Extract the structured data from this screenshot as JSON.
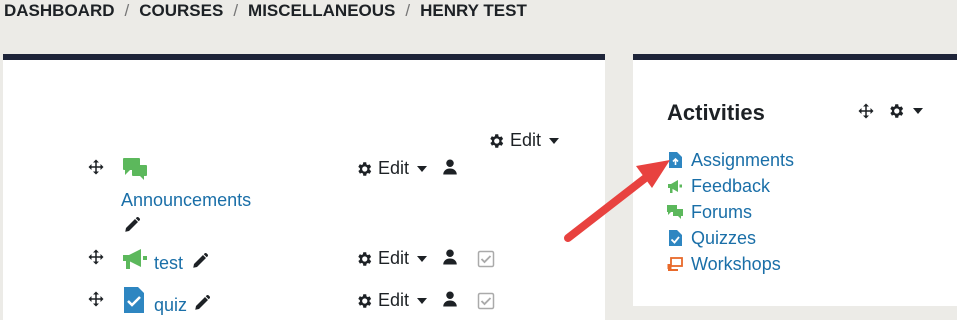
{
  "breadcrumb": {
    "items": [
      "DASHBOARD",
      "COURSES",
      "MISCELLANEOUS",
      "HENRY TEST"
    ],
    "separator": "/"
  },
  "section": {
    "edit_label": "Edit"
  },
  "activities_list": [
    {
      "name": "Announcements",
      "icon": "forum-icon",
      "edit_label": "Edit"
    },
    {
      "name": "test",
      "icon": "feedback-icon",
      "edit_label": "Edit"
    },
    {
      "name": "quiz",
      "icon": "quiz-icon",
      "edit_label": "Edit"
    }
  ],
  "activities_block": {
    "title": "Activities",
    "items": [
      {
        "label": "Assignments",
        "icon": "assignment-icon"
      },
      {
        "label": "Feedback",
        "icon": "feedback-icon"
      },
      {
        "label": "Forums",
        "icon": "forum-icon"
      },
      {
        "label": "Quizzes",
        "icon": "quiz-icon"
      },
      {
        "label": "Workshops",
        "icon": "workshop-icon"
      }
    ]
  },
  "colors": {
    "header_bar": "#1e2439",
    "link": "#1a6fa8",
    "forum_green": "#5cb85c",
    "assign_blue": "#2e86c1",
    "workshop_orange": "#e8692a",
    "arrow_red": "#e8423f"
  }
}
